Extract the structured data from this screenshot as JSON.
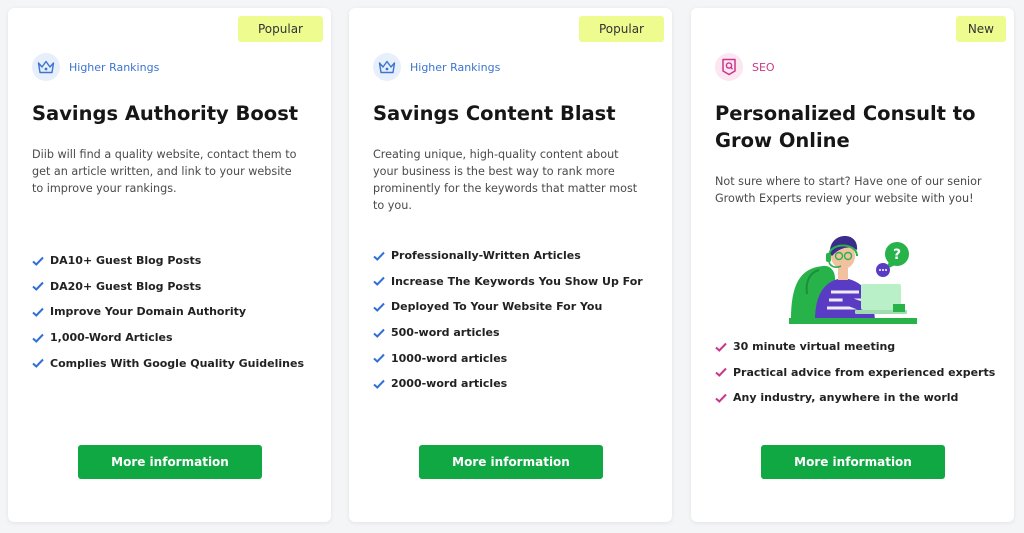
{
  "colors": {
    "badge_bg": "#eefc8f",
    "cta_green": "#10a843",
    "check_blue": "#2f6fd6",
    "check_pink": "#c9378a",
    "category_blue": "#3c74d0",
    "category_pink": "#c9378a"
  },
  "cards": [
    {
      "badge": "Popular",
      "category": {
        "label": "Higher Rankings",
        "icon": "crown-icon"
      },
      "title": "Savings Authority Boost",
      "description": "Diib will find a quality website, contact them to get an article written, and link to your website to improve your rankings.",
      "features": [
        "DA10+ Guest Blog Posts",
        "DA20+ Guest Blog Posts",
        "Improve Your Domain Authority",
        "1,000-Word Articles",
        "Complies With Google Quality Guidelines"
      ],
      "cta": "More information"
    },
    {
      "badge": "Popular",
      "category": {
        "label": "Higher Rankings",
        "icon": "crown-icon"
      },
      "title": "Savings Content Blast",
      "description": "Creating unique, high-quality content about your business is the best way to rank more prominently for the keywords that matter most to you.",
      "features": [
        "Professionally-Written Articles",
        "Increase The Keywords You Show Up For",
        "Deployed To Your Website For You",
        "500-word articles",
        "1000-word articles",
        "2000-word articles"
      ],
      "cta": "More information"
    },
    {
      "badge": "New",
      "category": {
        "label": "SEO",
        "icon": "seo-search-icon"
      },
      "title": "Personalized Consult to Grow Online",
      "description": "Not sure where to start? Have one of our senior Growth Experts review your website with you!",
      "illustration": "consultant-with-headset-icon",
      "features": [
        "30 minute virtual meeting",
        "Practical advice from experienced experts",
        "Any industry, anywhere in the world"
      ],
      "cta": "More information"
    }
  ]
}
